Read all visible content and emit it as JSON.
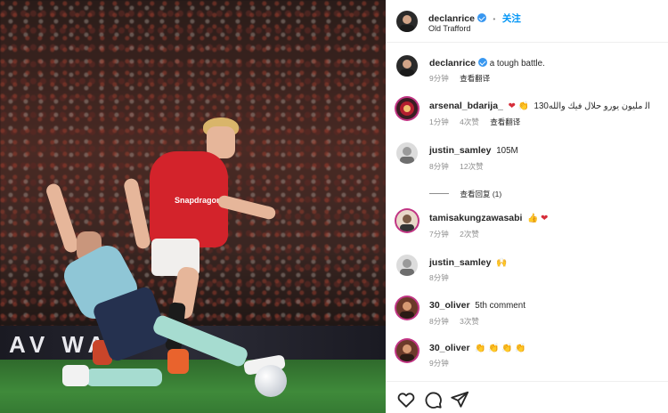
{
  "post": {
    "username": "declanrice",
    "follow_label": "关注",
    "location": "Old Trafford",
    "ad_text": "AV  WA",
    "sponsor_text": "Snapdragon",
    "caption": "a tough battle.",
    "caption_time": "9分钟",
    "caption_translate": "查看翻译"
  },
  "comments": [
    {
      "user": "arsenal_bdarija_",
      "text": "130اﻟ مليون يورو حلال فيك والله",
      "emoji": "❤ 👏",
      "time": "1分钟",
      "likes": "4次赞",
      "translate": "查看翻译"
    },
    {
      "user": "justin_samley",
      "text": "105M",
      "emoji": "",
      "time": "8分钟",
      "likes": "12次赞",
      "translate": ""
    },
    {
      "user": "tamisakungzawasabi",
      "text": "",
      "emoji": "👍 ❤",
      "time": "7分钟",
      "likes": "2次赞",
      "translate": ""
    },
    {
      "user": "justin_samley",
      "text": "",
      "emoji": "🙌",
      "time": "8分钟",
      "likes": "",
      "translate": ""
    },
    {
      "user": "30_oliver",
      "text": "5th comment",
      "emoji": "",
      "time": "8分钟",
      "likes": "3次赞",
      "translate": ""
    },
    {
      "user": "30_oliver",
      "text": "",
      "emoji": "👏 👏 👏 👏",
      "time": "9分钟",
      "likes": "",
      "translate": ""
    }
  ],
  "view_replies": "查看回复 (1)",
  "colors": {
    "accent": "#0095f6",
    "verified": "#3897f0",
    "meta": "#8e8e8e"
  },
  "icons": [
    "heart-icon",
    "comment-icon",
    "share-icon",
    "verified-icon",
    "more-icon"
  ]
}
